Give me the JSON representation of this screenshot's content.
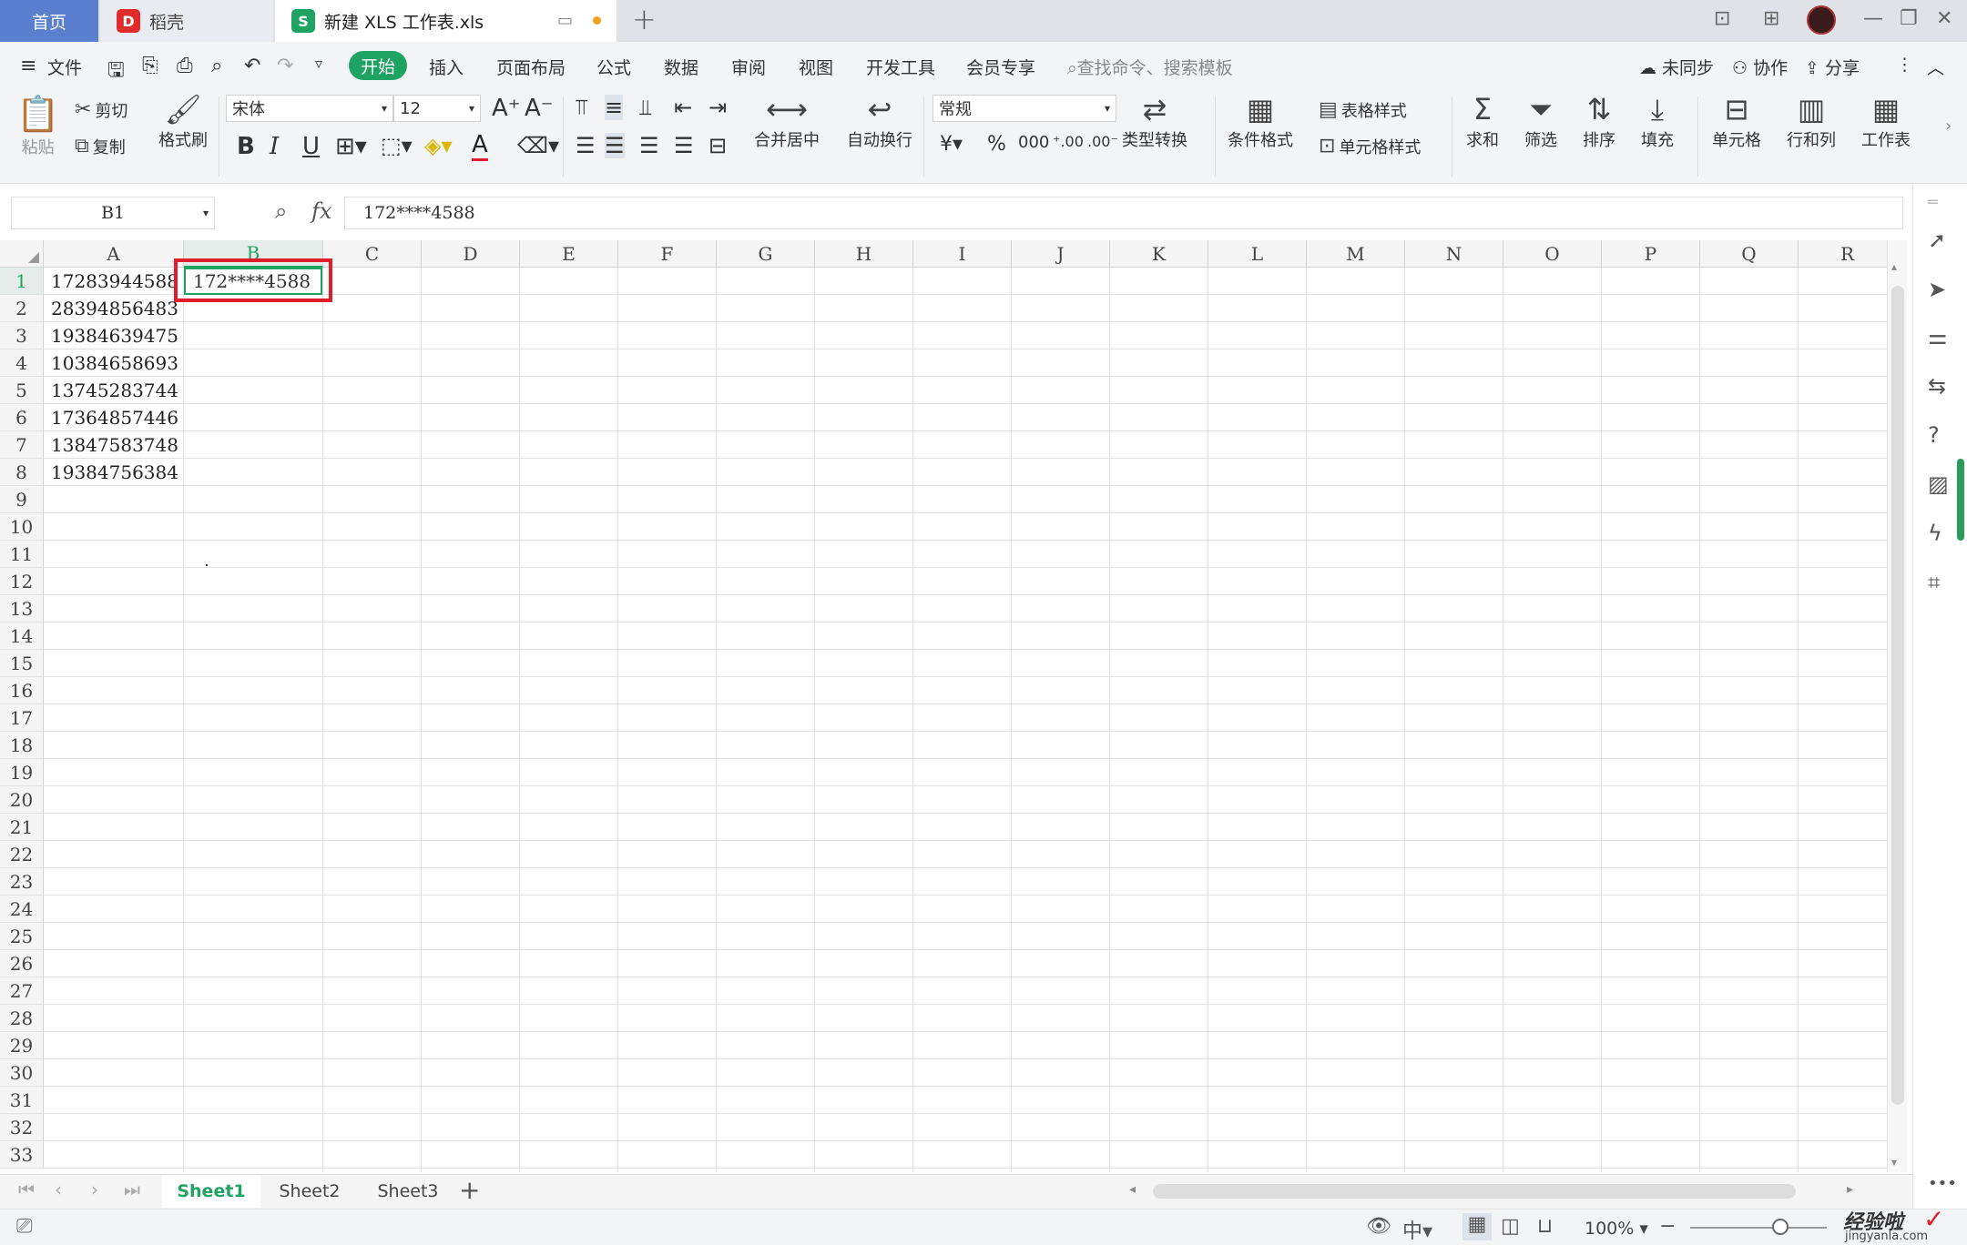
{
  "tabs": {
    "home": "首页",
    "daoke": "稻壳",
    "file": "新建 XLS 工作表.xls"
  },
  "menu": {
    "file": "文件",
    "start": "开始",
    "items": [
      "插入",
      "页面布局",
      "公式",
      "数据",
      "审阅",
      "视图",
      "开发工具",
      "会员专享"
    ],
    "search_placeholder": "查找命令、搜索模板",
    "sync": "未同步",
    "collab": "协作",
    "share": "分享"
  },
  "ribbon": {
    "paste": "粘贴",
    "cut": "剪切",
    "copy": "复制",
    "format_painter": "格式刷",
    "font_name": "宋体",
    "font_size": "12",
    "merge_center": "合并居中",
    "wrap_text": "自动换行",
    "number_format": "常规",
    "type_convert": "类型转换",
    "conditional_format": "条件格式",
    "table_style": "表格样式",
    "cell_style": "单元格样式",
    "sum": "求和",
    "filter": "筛选",
    "sort": "排序",
    "fill": "填充",
    "cell": "单元格",
    "row_col": "行和列",
    "worksheet": "工作表"
  },
  "formula_bar": {
    "name_box": "B1",
    "fx": "fx",
    "value": "172****4588"
  },
  "grid": {
    "columns": [
      "A",
      "B",
      "C",
      "D",
      "E",
      "F",
      "G",
      "H",
      "I",
      "J",
      "K",
      "L",
      "M",
      "N",
      "O",
      "P",
      "Q",
      "R"
    ],
    "rows": [
      "1",
      "2",
      "3",
      "4",
      "5",
      "6",
      "7",
      "8",
      "9",
      "10",
      "11",
      "12",
      "13",
      "14",
      "15",
      "16",
      "17",
      "18",
      "19",
      "20",
      "21",
      "22",
      "23",
      "24",
      "25",
      "26",
      "27",
      "28",
      "29",
      "30",
      "31",
      "32",
      "33"
    ],
    "col_a": [
      "17283944588",
      "28394856483",
      "19384639475",
      "10384658693",
      "13745283744",
      "17364857446",
      "13847583748",
      "19384756384"
    ],
    "b1": "172****4588"
  },
  "sheets": [
    "Sheet1",
    "Sheet2",
    "Sheet3"
  ],
  "status": {
    "zoom": "100%"
  },
  "watermark": {
    "line1": "经验啦",
    "line2": "jingyanla.com"
  },
  "colors": {
    "accent_green": "#1fa362",
    "highlight_red": "#e01d2a",
    "home_tab": "#5b7fcf"
  }
}
